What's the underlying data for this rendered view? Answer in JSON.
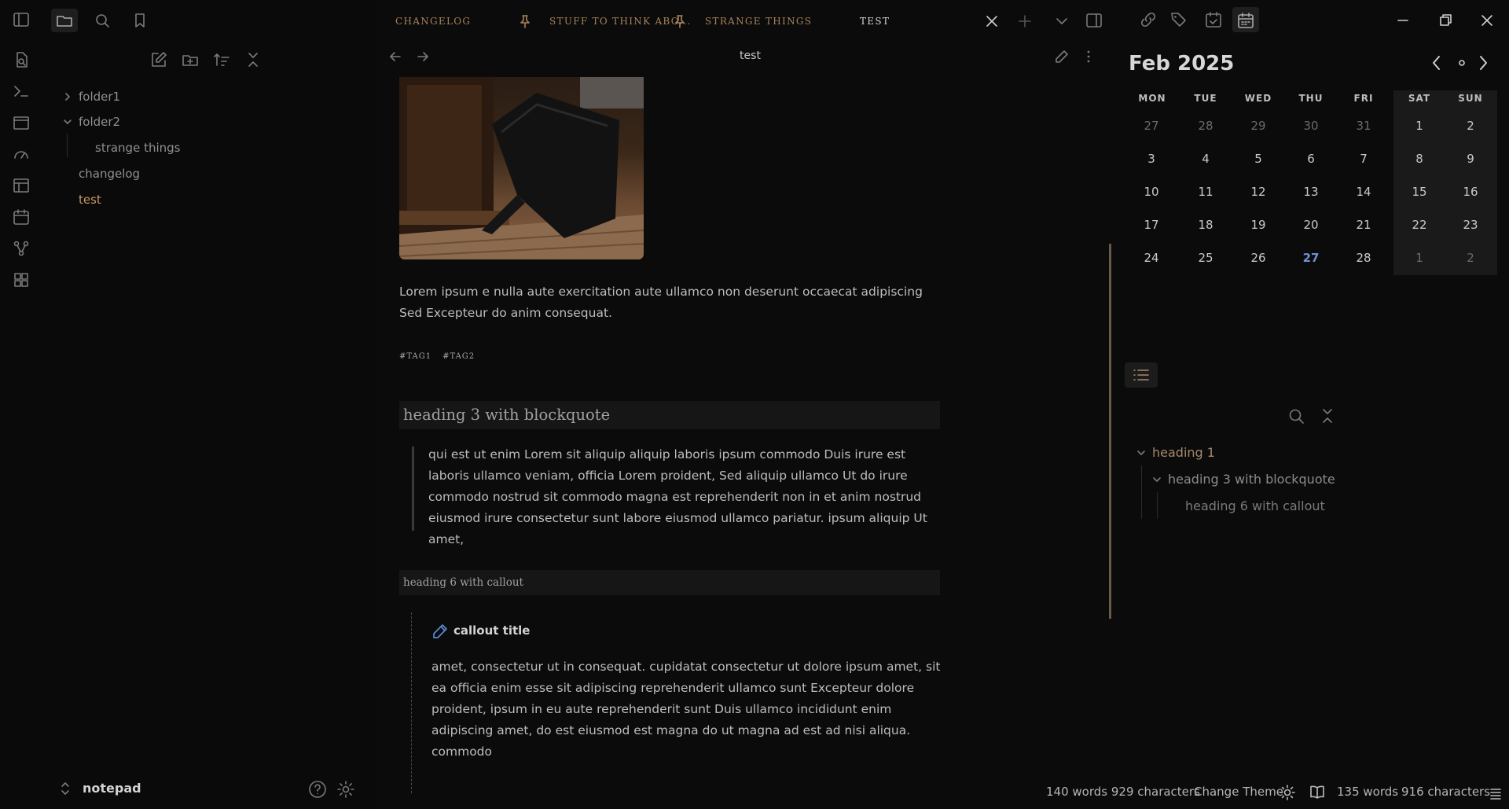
{
  "ribbon": {
    "icons": [
      "collapse-sidebar-icon",
      "search-in-files-icon",
      "terminal-icon",
      "canvas-icon",
      "dashboard-icon",
      "layout-icon",
      "calendar-icon",
      "graph-view-icon",
      "plugins-grid-icon"
    ]
  },
  "sidebar": {
    "tree": [
      {
        "label": "folder1",
        "type": "folder",
        "expanded": false
      },
      {
        "label": "folder2",
        "type": "folder",
        "expanded": true
      },
      {
        "label": "strange things",
        "type": "file"
      },
      {
        "label": "changelog",
        "type": "file"
      },
      {
        "label": "test",
        "type": "file",
        "active": true
      }
    ],
    "vault_name": "notepad"
  },
  "tabs": [
    {
      "label": "CHANGELOG",
      "pinned": false,
      "active": false
    },
    {
      "label": "STUFF TO THINK ABO...",
      "pinned": true,
      "active": false
    },
    {
      "label": "STRANGE THINGS",
      "pinned": true,
      "active": false
    },
    {
      "label": "TEST",
      "pinned": false,
      "active": true
    }
  ],
  "editor": {
    "title": "test",
    "paragraph": "Lorem ipsum e nulla aute exercitation aute ullamco non deserunt occaecat adipiscing Sed Excepteur do anim consequat.",
    "tags": [
      "#TAG1",
      "#TAG2"
    ],
    "heading3": "heading 3 with blockquote",
    "blockquote": "qui est ut enim Lorem sit aliquip aliquip laboris ipsum commodo Duis irure est laboris ullamco veniam, officia Lorem proident, Sed aliquip ullamco Ut do irure commodo nostrud sit commodo magna est reprehenderit non in et anim nostrud eiusmod irure consectetur sunt labore eiusmod ullamco pariatur. ipsum aliquip Ut amet,",
    "heading6": "heading 6 with callout",
    "callout_title": "callout title",
    "callout_body": "amet, consectetur ut in consequat. cupidatat consectetur ut dolore ipsum amet, sit ea officia enim esse sit adipiscing reprehenderit ullamco sunt Excepteur dolore proident, ipsum in eu aute reprehenderit sunt Duis ullamco incididunt enim adipiscing amet, do est eiusmod est magna do ut magna ad est ad nisi aliqua. commodo"
  },
  "calendar": {
    "month_label": "Feb 2025",
    "weekdays": [
      "MON",
      "TUE",
      "WED",
      "THU",
      "FRI",
      "SAT",
      "SUN"
    ],
    "weeks": [
      [
        "27",
        "28",
        "29",
        "30",
        "31",
        "1",
        "2"
      ],
      [
        "3",
        "4",
        "5",
        "6",
        "7",
        "8",
        "9"
      ],
      [
        "10",
        "11",
        "12",
        "13",
        "14",
        "15",
        "16"
      ],
      [
        "17",
        "18",
        "19",
        "20",
        "21",
        "22",
        "23"
      ],
      [
        "24",
        "25",
        "26",
        "27",
        "28",
        "1",
        "2"
      ]
    ],
    "today": "27",
    "colors": {
      "today": "#6f8fd6",
      "weekend_bg": "#1a1a1a",
      "dim": "#6a6a6a"
    }
  },
  "outline": {
    "items": [
      {
        "label": "heading 1",
        "level": 1
      },
      {
        "label": "heading 3 with blockquote",
        "level": 2
      },
      {
        "label": "heading 6 with callout",
        "level": 3
      }
    ]
  },
  "status_bar": {
    "word_count_left": "140 words 929 characters",
    "theme_button": "Change Theme",
    "word_count_right": "135 words",
    "char_count_right": "916 characters"
  },
  "colors": {
    "accent": "#a7835a",
    "callout_icon": "#5b8ad6",
    "background": "#0b0b0b"
  }
}
